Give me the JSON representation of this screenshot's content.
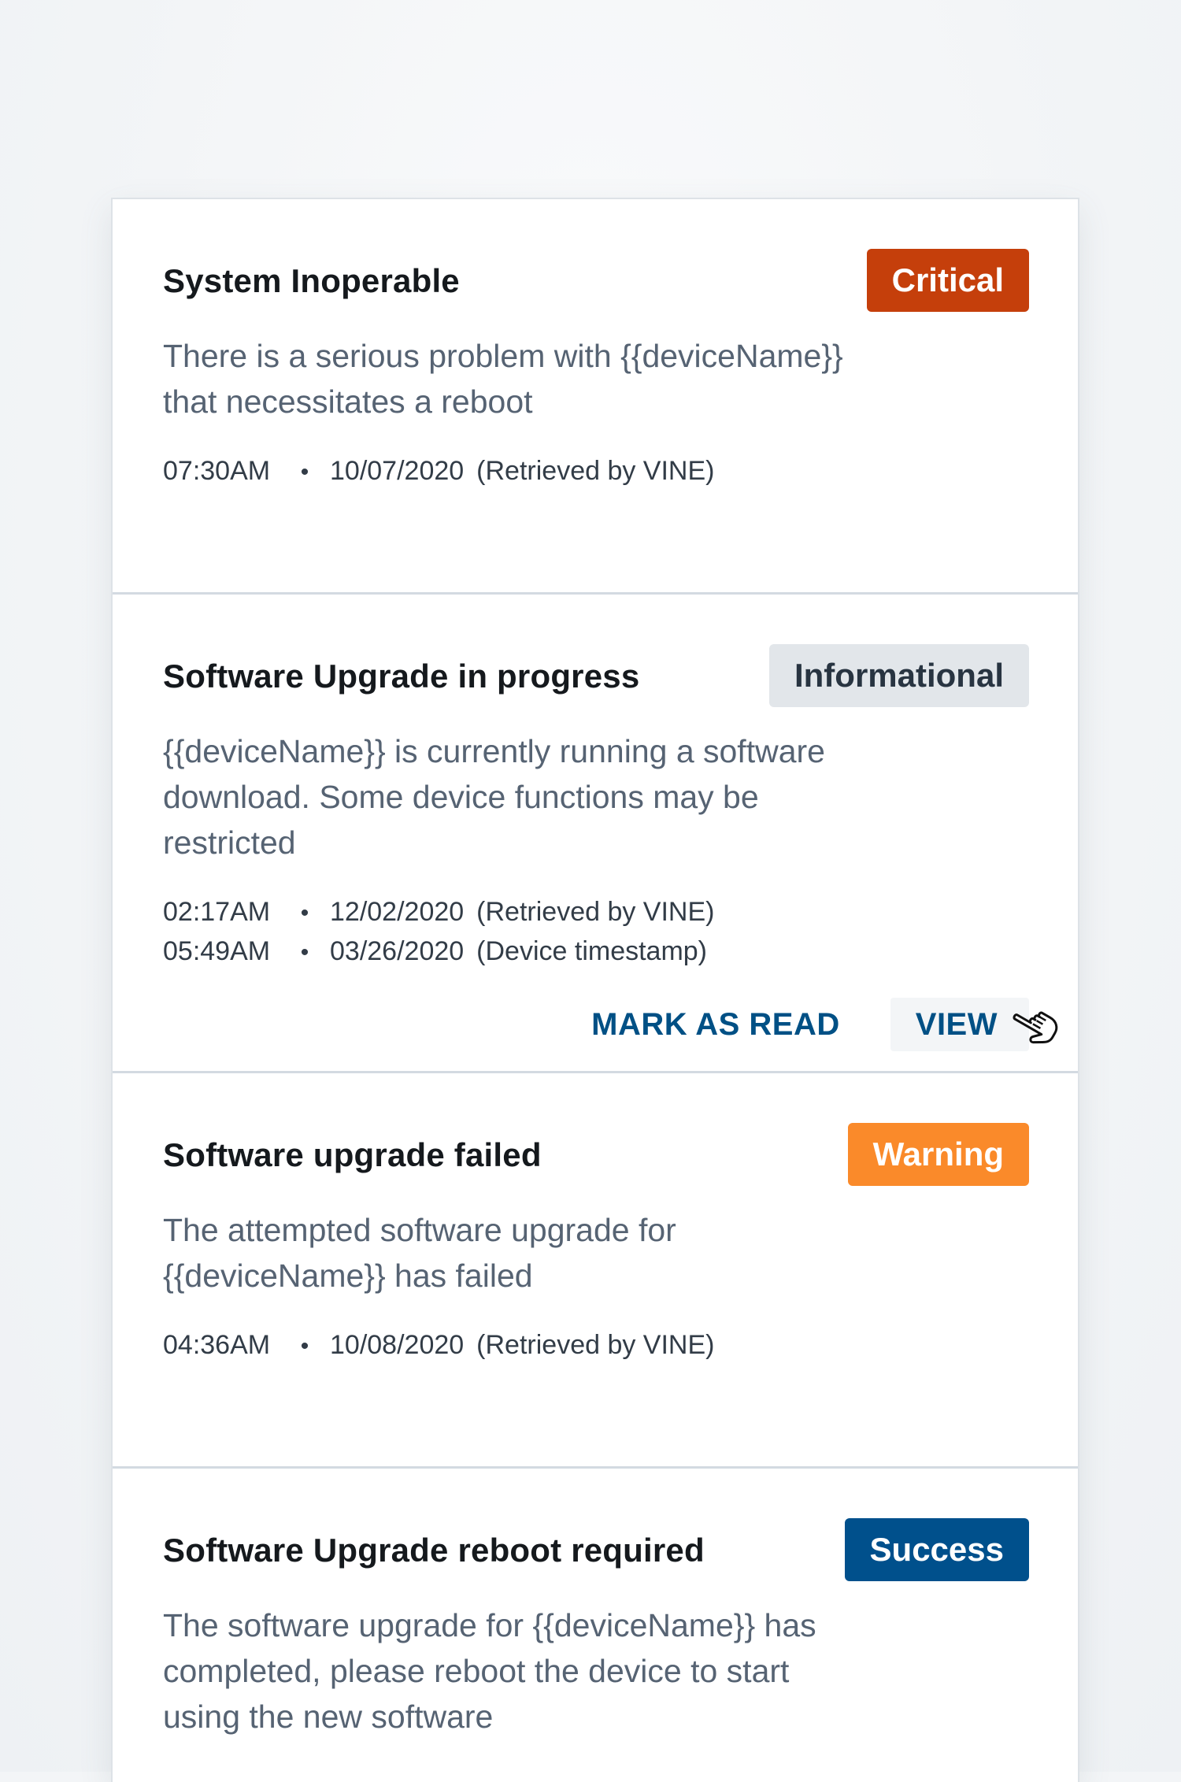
{
  "notifications": [
    {
      "title": "System Inoperable",
      "badge": "Critical",
      "badge_color": "#c53f0b",
      "description": "There is a serious problem with {{deviceName}} that necessitates a reboot",
      "meta": [
        {
          "time": "07:30AM",
          "date": "10/07/2020",
          "source": "(Retrieved by VINE)"
        }
      ]
    },
    {
      "title": "Software Upgrade in progress",
      "badge": "Informational",
      "badge_color": "#e2e6ea",
      "description": "{{deviceName}} is currently running a software download. Some device functions may be restricted",
      "meta": [
        {
          "time": "02:17AM",
          "date": "12/02/2020",
          "source": "(Retrieved by VINE)"
        },
        {
          "time": "05:49AM",
          "date": "03/26/2020",
          "source": "(Device timestamp)"
        }
      ],
      "actions": {
        "mark_read_label": "MARK AS READ",
        "view_label": "VIEW"
      }
    },
    {
      "title": "Software upgrade failed",
      "badge": "Warning",
      "badge_color": "#fa8a2a",
      "description": "The attempted software upgrade for {{deviceName}} has failed",
      "meta": [
        {
          "time": "04:36AM",
          "date": "10/08/2020",
          "source": "(Retrieved by VINE)"
        }
      ]
    },
    {
      "title": "Software Upgrade reboot required",
      "badge": "Success",
      "badge_color": "#00508c",
      "description": "The software upgrade for {{deviceName}} has completed, please reboot the device to start using the new software"
    }
  ],
  "meta_separator": "•",
  "colors": {
    "background": "#f3f5f7",
    "action_text": "#005085",
    "divider": "#d3dae1"
  },
  "icons": {
    "cursor": "hand-pointer-cursor-icon"
  }
}
